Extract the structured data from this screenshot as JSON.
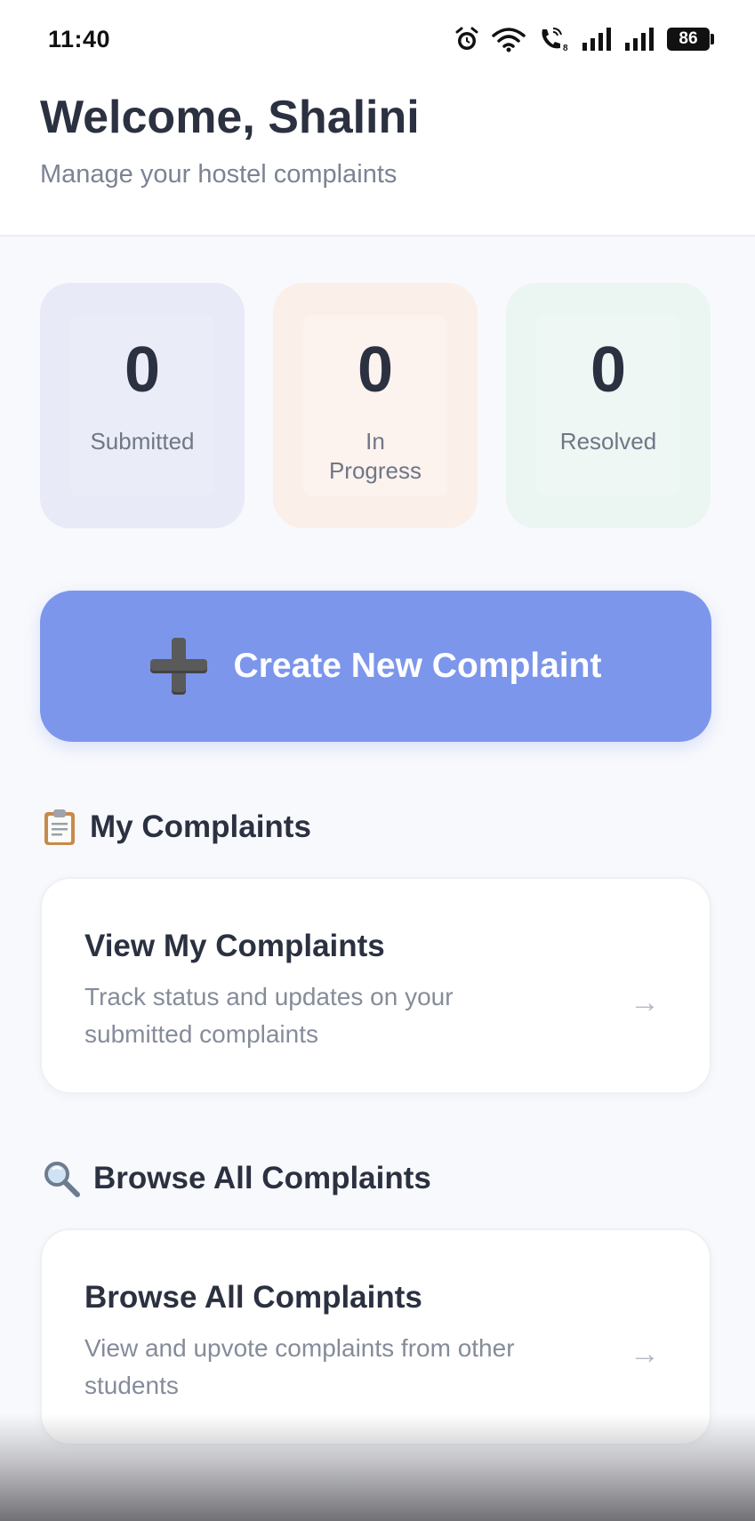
{
  "status_bar": {
    "time": "11:40",
    "icons": [
      "alarm-icon",
      "wifi-icon",
      "wifi-call-icon",
      "signal-icon",
      "signal-icon"
    ],
    "battery": "86"
  },
  "header": {
    "title": "Welcome, Shalini",
    "subtitle": "Manage your hostel complaints"
  },
  "stats": [
    {
      "value": "0",
      "label": "Submitted",
      "color": "#e8eaf8"
    },
    {
      "value": "0",
      "label": "In\nProgress",
      "color": "#fbefe9"
    },
    {
      "value": "0",
      "label": "Resolved",
      "color": "#ebf5f1"
    }
  ],
  "create_button": {
    "icon": "plus-icon",
    "label": "Create New Complaint",
    "color": "#7c96ec"
  },
  "my_complaints": {
    "heading_icon": "clipboard-icon",
    "heading": "My Complaints",
    "card_title": "View My Complaints",
    "card_description": "Track status and updates on your submitted complaints",
    "arrow": "→"
  },
  "browse_complaints": {
    "heading_icon": "magnifier-icon",
    "heading": "Browse All Complaints",
    "card_title": "Browse All Complaints",
    "card_description": "View and upvote complaints from other students",
    "arrow": "→"
  }
}
